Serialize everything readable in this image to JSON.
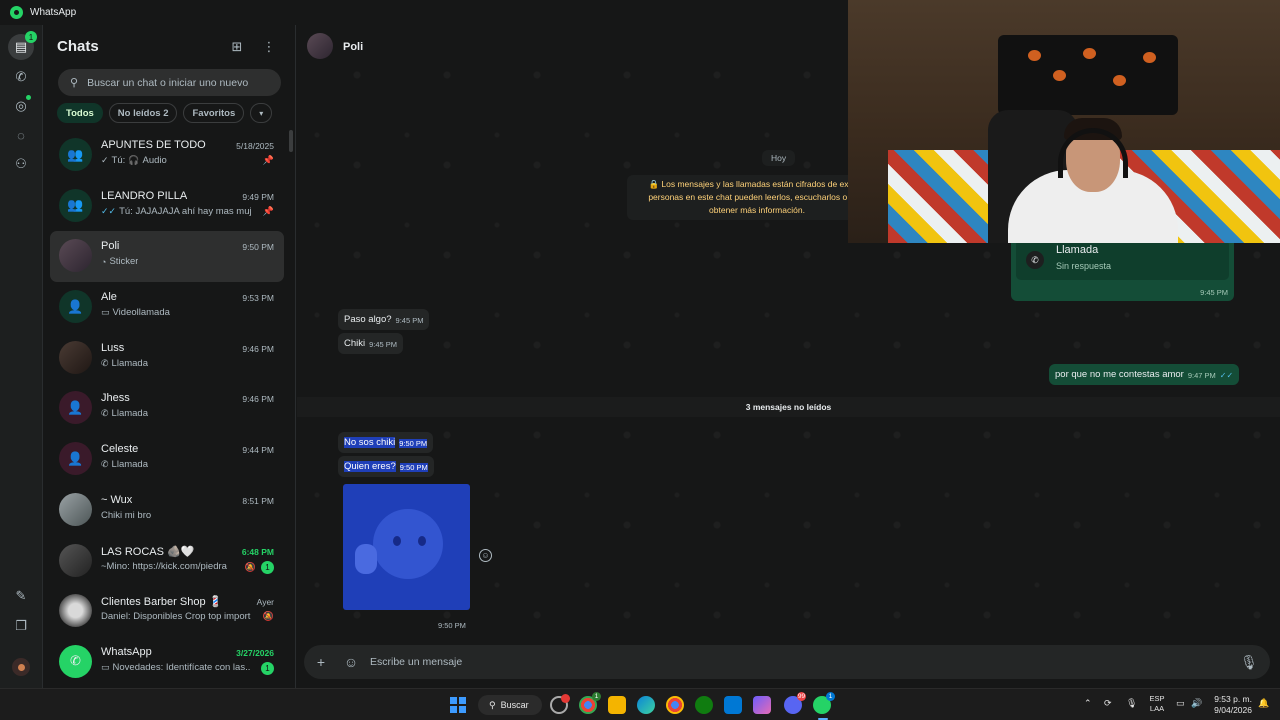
{
  "window": {
    "title": "WhatsApp"
  },
  "rail": {
    "chats_badge": "1"
  },
  "chat_list": {
    "title": "Chats",
    "search_placeholder": "Buscar un chat o iniciar uno nuevo",
    "filters": [
      {
        "label": "Todos",
        "active": true
      },
      {
        "label": "No leídos 2",
        "active": false
      },
      {
        "label": "Favoritos",
        "active": false
      }
    ],
    "chats": [
      {
        "name": "APUNTES DE TODO",
        "time": "5/18/2025",
        "preview": "Tú:",
        "preview2": "Audio",
        "avatar": "group",
        "pinned": true
      },
      {
        "name": "LEANDRO PILLA",
        "time": "9:49 PM",
        "preview": "Tú: JAJAJAJA ahí hay mas muje...",
        "avatar": "group",
        "pinned": true
      },
      {
        "name": "Poli",
        "time": "9:50 PM",
        "preview": "Sticker",
        "avatar": "photo",
        "selected": true
      },
      {
        "name": "Ale",
        "time": "9:53 PM",
        "preview": "Videollamada",
        "avatar": "person-blue"
      },
      {
        "name": "Luss",
        "time": "9:46 PM",
        "preview": "Llamada",
        "avatar": "photo2"
      },
      {
        "name": "Jhess",
        "time": "9:46 PM",
        "preview": "Llamada",
        "avatar": "person-pink"
      },
      {
        "name": "Celeste",
        "time": "9:44 PM",
        "preview": "Llamada",
        "avatar": "person-pink"
      },
      {
        "name": "~ Wux",
        "time": "8:51 PM",
        "preview": "Chiki mi bro",
        "avatar": "photo3"
      },
      {
        "name": "LAS ROCAS 🪨🤍",
        "time": "6:48 PM",
        "preview": "~Mino: https://kick.com/piedra",
        "avatar": "photo4",
        "unread": "1",
        "muted": true
      },
      {
        "name": "Clientes Barber Shop 💈",
        "time": "Ayer",
        "preview": "Daniel: Disponibles Crop top import...",
        "avatar": "photo5",
        "muted": true
      },
      {
        "name": "WhatsApp",
        "time": "3/27/2026",
        "preview": "Novedades: Identifícate con las...",
        "avatar": "wa",
        "unread": "1"
      }
    ]
  },
  "conversation": {
    "contact_name": "Poli",
    "day_label": "Hoy",
    "encryption_lines": [
      "🔒 Los mensajes y las llamadas están cifrados de extrem",
      "personas en este chat pueden leerlos, escucharlos o com",
      "obtener más información."
    ],
    "call": {
      "title": "Llamada",
      "subtitle": "Sin respuesta",
      "time": "9:45 PM"
    },
    "messages_before": [
      {
        "text": "Paso algo?",
        "time": "9:45 PM"
      },
      {
        "text": "Chiki",
        "time": "9:45 PM"
      }
    ],
    "outgoing": {
      "text": "por que no me contestas amor",
      "time": "9:47 PM"
    },
    "unread_divider": "3 mensajes no leídos",
    "messages_after": [
      {
        "text": "No sos chiki",
        "time": "9:50 PM"
      },
      {
        "text": "Quien eres?",
        "time": "9:50 PM"
      }
    ],
    "sticker_time": "9:50 PM",
    "composer_placeholder": "Escribe un mensaje"
  },
  "taskbar": {
    "search_label": "Buscar",
    "lang_top": "ESP",
    "lang_bottom": "LAA",
    "time": "9:53 p. m.",
    "date": "9/04/2026",
    "whatsapp_badge": "1",
    "discord_badge": "99",
    "chrome_badge": "1"
  },
  "colors": {
    "accent": "#25d366",
    "outgoing_bubble": "#144d37",
    "incoming_bubble": "#242626",
    "selection_highlight": "#1f3fb8"
  }
}
